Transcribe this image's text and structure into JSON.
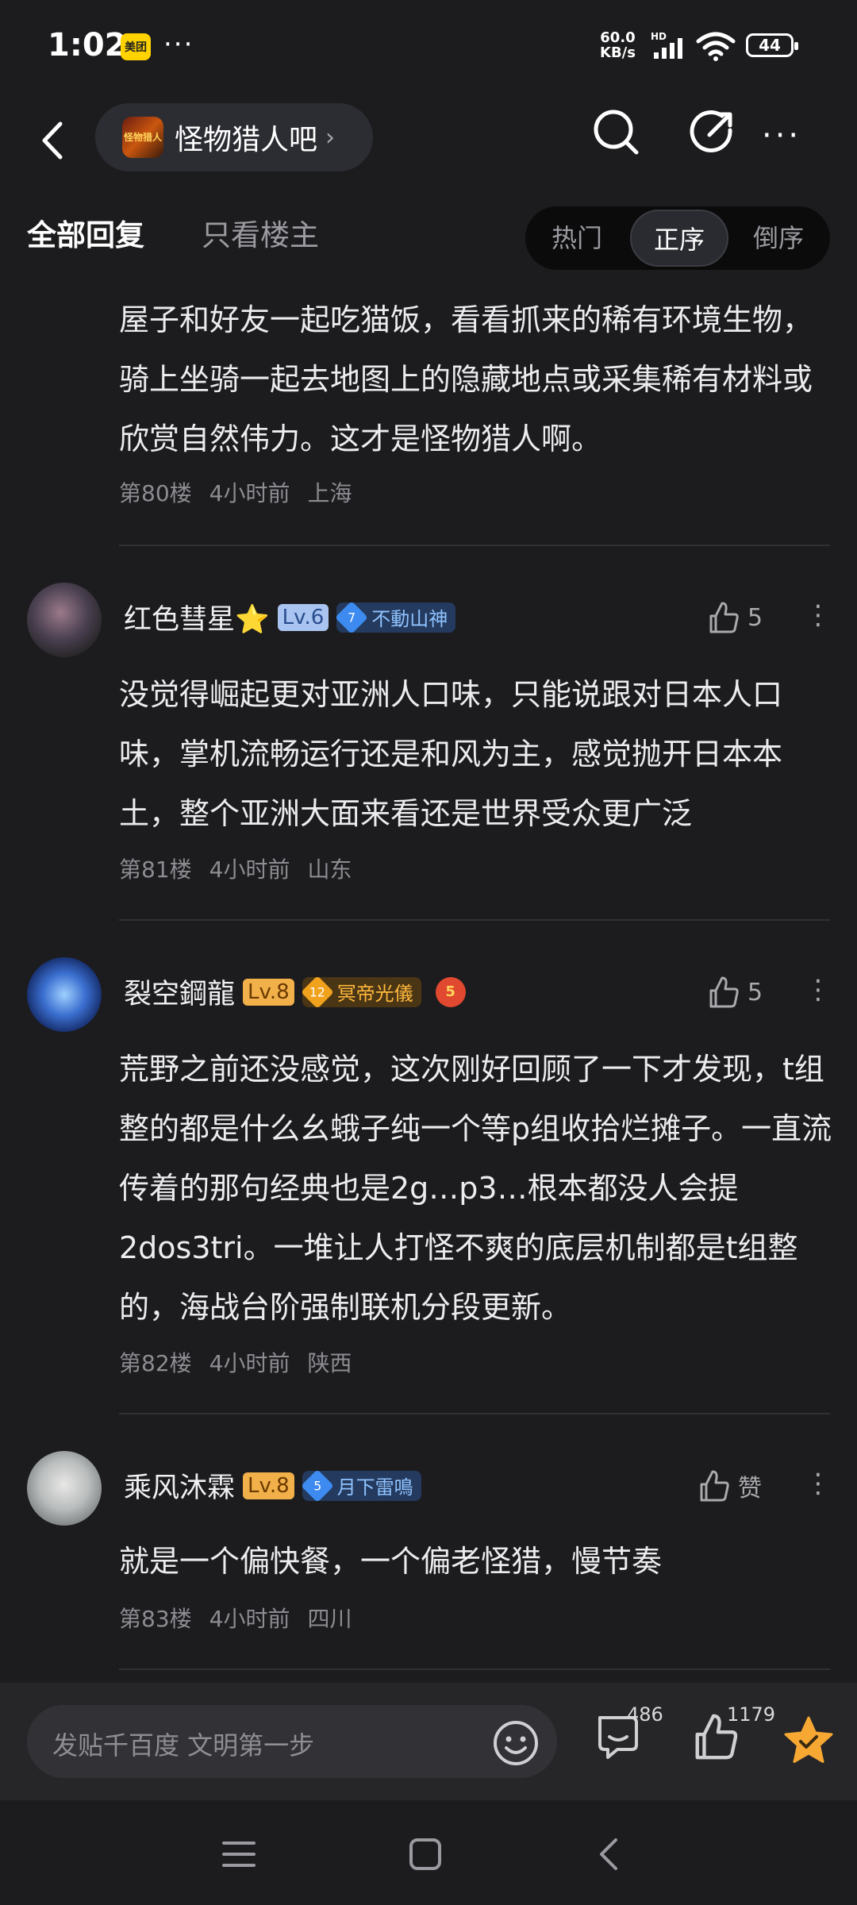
{
  "status_bar": {
    "time": "1:02",
    "meituan_label": "美团",
    "more_dots": "···",
    "net_speed_value": "60.0",
    "net_speed_unit": "KB/s",
    "network": "HD",
    "battery": "44"
  },
  "header": {
    "forum_name": "怪物猎人吧",
    "forum_logo_text": "怪物猎人"
  },
  "filter": {
    "tab_all": "全部回复",
    "tab_op_only": "只看楼主",
    "sort_hot": "热门",
    "sort_asc": "正序",
    "sort_desc": "倒序",
    "active_sort": "正序"
  },
  "posts": [
    {
      "text": "屋子和好友一起吃猫饭，看看抓来的稀有环境生物，骑上坐骑一起去地图上的隐藏地点或采集稀有材料或欣赏自然伟力。这才是怪物猎人啊。",
      "floor": "第80楼",
      "time": "4小时前",
      "location": "上海"
    },
    {
      "username": "红色彗星⭐",
      "level": "Lv.6",
      "badge_num": "7",
      "badge_text": "不動山神",
      "likes": "5",
      "text": "没觉得崛起更对亚洲人口味，只能说跟对日本人口味，掌机流畅运行还是和风为主，感觉抛开日本本土，整个亚洲大面来看还是世界受众更广泛",
      "floor": "第81楼",
      "time": "4小时前",
      "location": "山东"
    },
    {
      "username": "裂空鋼龍",
      "level": "Lv.8",
      "badge_num": "12",
      "badge_text": "冥帝光儀",
      "extra_badge": "5",
      "likes": "5",
      "text": "荒野之前还没感觉，这次刚好回顾了一下才发现，t组整的都是什么幺蛾子纯一个等p组收拾烂摊子。一直流传着的那句经典也是2g…p3…根本都没人会提2dos3tri。一堆让人打怪不爽的底层机制都是t组整的，海战台阶强制联机分段更新。",
      "floor": "第82楼",
      "time": "4小时前",
      "location": "陕西"
    },
    {
      "username": "乘风沐霖",
      "level": "Lv.8",
      "badge_num": "5",
      "badge_text": "月下雷鳴",
      "likes": "赞",
      "text": "就是一个偏快餐，一个偏老怪猎，慢节奏",
      "floor": "第83楼",
      "time": "4小时前",
      "location": "四川"
    }
  ],
  "bottom_bar": {
    "reply_placeholder": "发贴千百度 文明第一步",
    "comment_count": "486",
    "like_count": "1179"
  },
  "colors": {
    "background": "#1c1c1e",
    "accent_star": "#f7a833",
    "level_blue": "#a9c4f0",
    "level_orange": "#f2b04a"
  }
}
